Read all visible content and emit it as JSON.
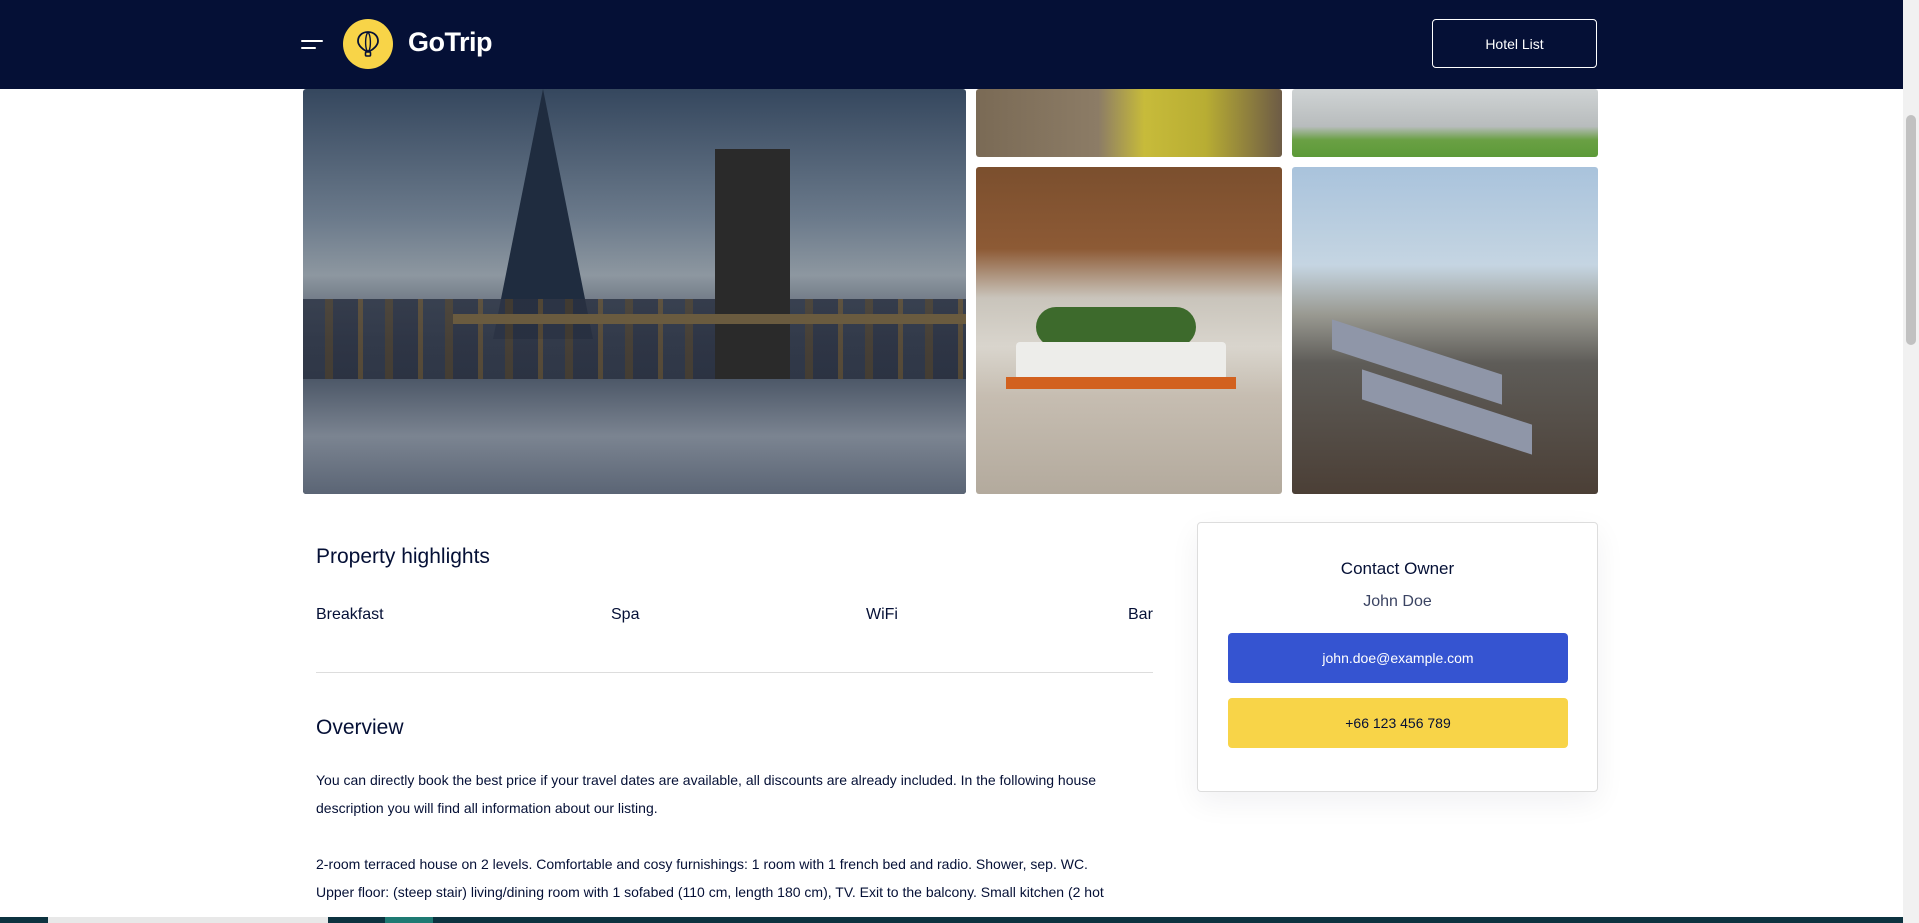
{
  "header": {
    "brand": "GoTrip",
    "hotel_list_label": "Hotel List",
    "menu_icon": "hamburger-icon",
    "logo_icon": "hot-air-balloon-icon",
    "logo_color": "#f8d448",
    "background_color": "#051036"
  },
  "gallery": {
    "images": [
      "city-skyline-tower-bridge",
      "hotel-bedroom",
      "hotel-exterior-garden",
      "hotel-lounge",
      "rooftop-terrace-loungers"
    ]
  },
  "highlights": {
    "title": "Property highlights",
    "items": [
      "Breakfast",
      "Spa",
      "WiFi",
      "Bar"
    ]
  },
  "overview": {
    "title": "Overview",
    "paragraph1_line1": "You can directly book the best price if your travel dates are available, all discounts are already included. In the following house",
    "paragraph1_line2": "description you will find all information about our listing.",
    "paragraph2_line1": "2-room terraced house on 2 levels. Comfortable and cosy furnishings: 1 room with 1 french bed and radio. Shower, sep. WC.",
    "paragraph2_line2": "Upper floor: (steep stair) living/dining room with 1 sofabed (110 cm, length 180 cm), TV. Exit to the balcony. Small kitchen (2 hot"
  },
  "contact": {
    "title": "Contact Owner",
    "name": "John Doe",
    "email": "john.doe@example.com",
    "phone": "+66 123 456 789",
    "email_button_color": "#3554d1",
    "phone_button_color": "#f8d448"
  }
}
